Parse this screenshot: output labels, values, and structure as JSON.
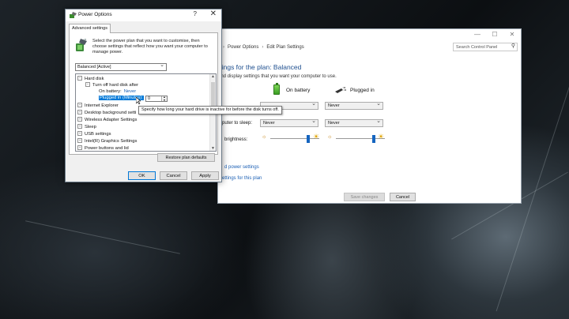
{
  "control_panel": {
    "breadcrumb": [
      "Power Options",
      "Edit Plan Settings"
    ],
    "search_placeholder": "Search Control Panel",
    "title": "ttings for the plan: Balanced",
    "subtitle": "and display settings that you want your computer to use.",
    "columns": {
      "battery": "On battery",
      "plugged": "Plugged in"
    },
    "rows": [
      {
        "label": "",
        "battery": "",
        "plugged": "Never"
      },
      {
        "label": "mputer to sleep:",
        "battery": "Never",
        "plugged": "Never"
      }
    ],
    "brightness_label": "brightness:",
    "brightness": {
      "battery": 0.8,
      "plugged": 0.8
    },
    "links": [
      "d power settings",
      "ettings for this plan"
    ],
    "save_button": "Save changes",
    "cancel_button": "Cancel"
  },
  "dialog": {
    "title": "Power Options",
    "help": "?",
    "close": "✕",
    "tab": "Advanced settings",
    "description": "Select the power plan that you want to customise, then choose settings that reflect how you want your computer to manage power.",
    "plan_selected": "Balanced [Active]",
    "tree": {
      "hard_disk": "Hard disk",
      "turn_off": "Turn off hard disk after",
      "on_battery_label": "On battery:",
      "on_battery_value": "Never",
      "plugged_label": "Plugged in (Minutes):",
      "plugged_value": "0",
      "items": [
        "Internet Explorer",
        "Desktop background setti",
        "Wireless Adapter Settings",
        "Sleep",
        "USB settings",
        "Intel(R) Graphics Settings",
        "Power buttons and lid"
      ]
    },
    "tooltip": "Specify how long your hard drive is inactive for before the disk turns off.",
    "restore_button": "Restore plan defaults",
    "ok_button": "OK",
    "cancel_button": "Cancel",
    "apply_button": "Apply"
  }
}
